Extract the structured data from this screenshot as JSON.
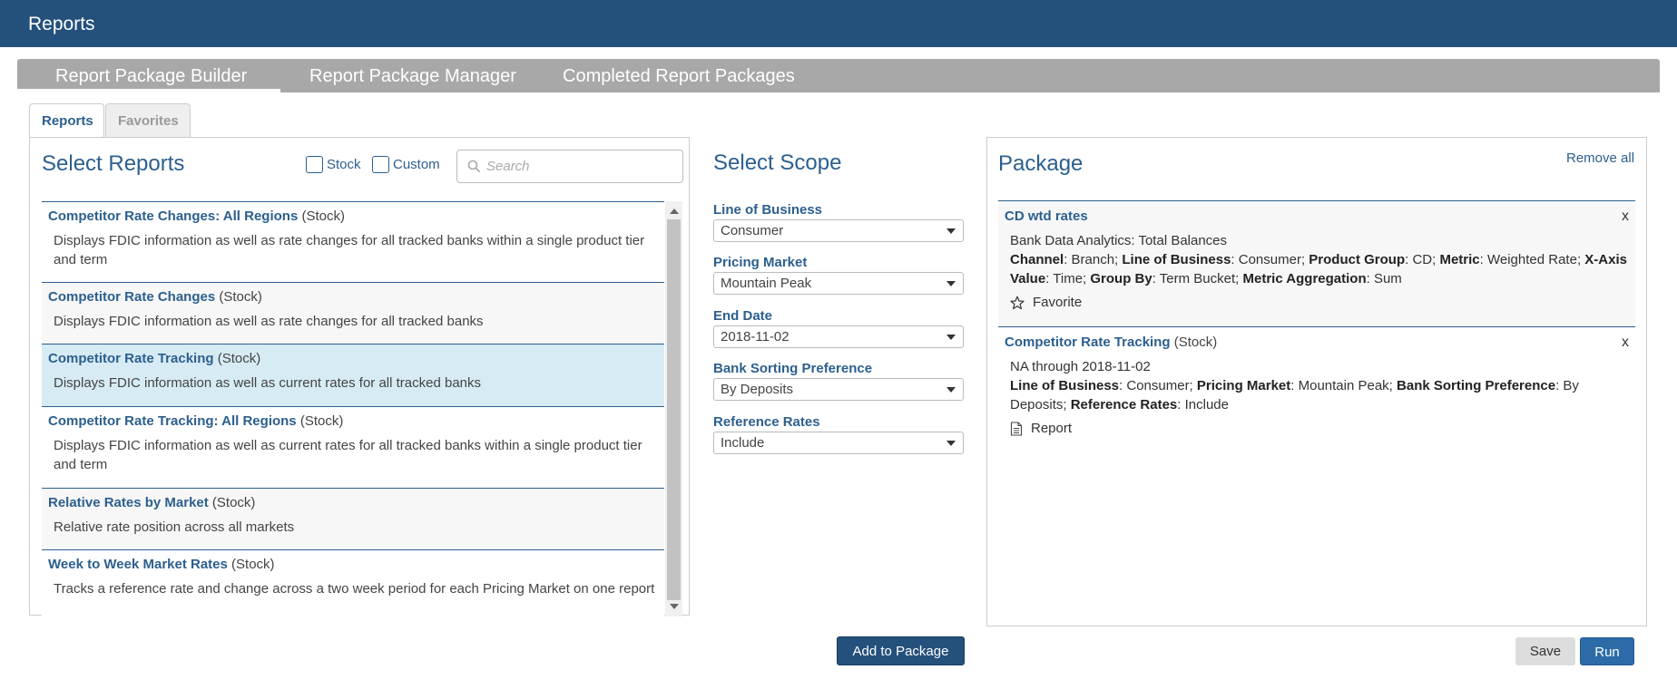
{
  "header": {
    "title": "Reports"
  },
  "main_nav": {
    "tabs": [
      {
        "label": "Report Package Builder"
      },
      {
        "label": "Report Package Manager"
      },
      {
        "label": "Completed Report Packages"
      }
    ]
  },
  "sub_tabs": [
    {
      "label": "Reports",
      "active": true
    },
    {
      "label": "Favorites",
      "active": false
    }
  ],
  "select_reports": {
    "title": "Select Reports",
    "filters": [
      {
        "label": "Stock",
        "checked": false
      },
      {
        "label": "Custom",
        "checked": false
      }
    ],
    "search": {
      "placeholder": "Search",
      "value": ""
    },
    "items": [
      {
        "name": "Competitor Rate Changes: All Regions",
        "type": "(Stock)",
        "description": "Displays FDIC information as well as rate changes for all tracked banks within a single product tier and term"
      },
      {
        "name": "Competitor Rate Changes",
        "type": "(Stock)",
        "description": "Displays FDIC information as well as rate changes for all tracked banks"
      },
      {
        "name": "Competitor Rate Tracking",
        "type": "(Stock)",
        "description": "Displays FDIC information as well as current rates for all tracked banks",
        "selected": true
      },
      {
        "name": "Competitor Rate Tracking: All Regions",
        "type": "(Stock)",
        "description": "Displays FDIC information as well as current rates for all tracked banks within a single product tier and term"
      },
      {
        "name": "Relative Rates by Market",
        "type": "(Stock)",
        "description": "Relative rate position across all markets"
      },
      {
        "name": "Week to Week Market Rates",
        "type": "(Stock)",
        "description": "Tracks a reference rate and change across a two week period for each Pricing Market on one report"
      }
    ]
  },
  "scope": {
    "title": "Select Scope",
    "fields": [
      {
        "label": "Line of Business",
        "value": "Consumer"
      },
      {
        "label": "Pricing Market",
        "value": "Mountain Peak"
      },
      {
        "label": "End Date",
        "value": "2018-11-02"
      },
      {
        "label": "Bank Sorting Preference",
        "value": "By Deposits"
      },
      {
        "label": "Reference Rates",
        "value": "Include"
      }
    ]
  },
  "package": {
    "title": "Package",
    "remove_all": "Remove all",
    "close_glyph": "x",
    "items": [
      {
        "name": "CD wtd rates",
        "subtitle": "Bank Data Analytics: Total Balances",
        "params": [
          {
            "key": "Channel",
            "val": ": Branch; "
          },
          {
            "key": "Line of Business",
            "val": ": Consumer; "
          },
          {
            "key": "Product Group",
            "val": ": CD; "
          },
          {
            "key": "Metric",
            "val": ": Weighted Rate; "
          },
          {
            "key": "X-Axis Value",
            "val": ": Time; "
          },
          {
            "key": "Group By",
            "val": ": Term Bucket; "
          },
          {
            "key": "Metric Aggregation",
            "val": ": Sum"
          }
        ],
        "action": "Favorite",
        "action_icon": "star-outline-icon"
      },
      {
        "name": "Competitor Rate Tracking",
        "type": "(Stock)",
        "subtitle": "NA through 2018-11-02",
        "params": [
          {
            "key": "Line of Business",
            "val": ": Consumer; "
          },
          {
            "key": "Pricing Market",
            "val": ": Mountain Peak; "
          },
          {
            "key": "Bank Sorting Preference",
            "val": ": By Deposits; "
          },
          {
            "key": "Reference Rates",
            "val": ": Include"
          }
        ],
        "action": "Report",
        "action_icon": "document-icon"
      }
    ]
  },
  "buttons": {
    "add_to_package": "Add to Package",
    "save": "Save",
    "run": "Run"
  },
  "colors": {
    "header_bg": "#24507c",
    "accent": "#2c5f8e",
    "nav_bg": "#a8a8a8",
    "selected_row": "#d7ebf4"
  }
}
